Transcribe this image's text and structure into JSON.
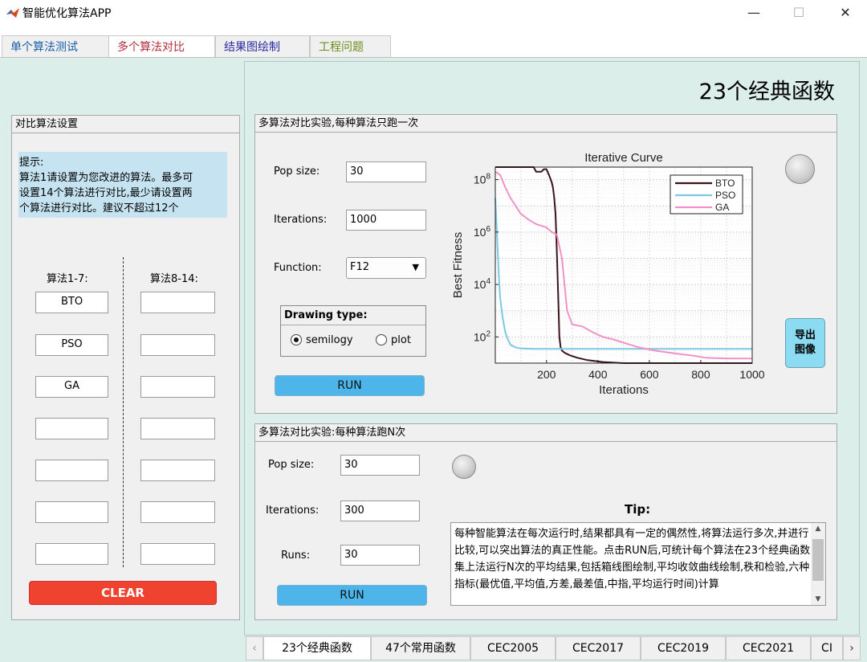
{
  "window": {
    "title": "智能优化算法APP",
    "minimize": "—",
    "maximize": "☐",
    "close": "✕"
  },
  "tabs": [
    {
      "label": "单个算法测试",
      "color": "#1a5fa8"
    },
    {
      "label": "多个算法对比",
      "color": "#b32d3a"
    },
    {
      "label": "结果图绘制",
      "color": "#2a2aa0"
    },
    {
      "label": "工程问题",
      "color": "#6c8c1c"
    }
  ],
  "heading": "23个经典函数",
  "compare_panel": {
    "title": "对比算法设置",
    "hint_lines": [
      "提示:",
      "算法1请设置为您改进的算法。最多可",
      "设置14个算法进行对比,最少请设置两",
      "个算法进行对比。建议不超过12个"
    ],
    "col1_label": "算法1-7:",
    "col2_label": "算法8-14:",
    "col1_values": [
      "BTO",
      "PSO",
      "GA",
      "",
      "",
      "",
      ""
    ],
    "col2_values": [
      "",
      "",
      "",
      "",
      "",
      "",
      ""
    ],
    "clear_label": "CLEAR"
  },
  "single_run_panel": {
    "title": "多算法对比实验,每种算法只跑一次",
    "pop_label": "Pop size:",
    "pop_value": "30",
    "iter_label": "Iterations:",
    "iter_value": "1000",
    "func_label": "Function:",
    "func_value": "F12",
    "drawing_type_label": "Drawing type:",
    "radio_semilogy": "semilogy",
    "radio_plot": "plot",
    "run_label": "RUN",
    "export_label_1": "导出",
    "export_label_2": "图像"
  },
  "multi_run_panel": {
    "title": "多算法对比实验:每种算法跑N次",
    "pop_label": "Pop size:",
    "pop_value": "30",
    "iter_label": "Iterations:",
    "iter_value": "300",
    "runs_label": "Runs:",
    "runs_value": "30",
    "run_label": "RUN",
    "tip_label": "Tip:",
    "tip_text": "每种智能算法在每次运行时,结果都具有一定的偶然性,将算法运行多次,并进行比较,可以突出算法的真正性能。点击RUN后,可统计每个算法在23个经典函数集上法运行N次的平均结果,包括箱线图绘制,平均收敛曲线绘制,秩和检验,六种指标(最优值,平均值,方差,最差值,中指,平均运行时间)计算"
  },
  "bottom_tabs": [
    "23个经典函数",
    "47个常用函数",
    "CEC2005",
    "CEC2017",
    "CEC2019",
    "CEC2021",
    "CI"
  ],
  "chart_data": {
    "type": "line",
    "title": "Iterative Curve",
    "xlabel": "Iterations",
    "ylabel": "Best Fitness",
    "xlim": [
      1,
      1000
    ],
    "ylim": [
      10,
      300000000
    ],
    "yscale": "log",
    "xticks": [
      200,
      400,
      600,
      800,
      1000
    ],
    "yticks": [
      100,
      10000,
      1000000,
      100000000
    ],
    "ytick_labels": [
      "10^2",
      "10^4",
      "10^6",
      "10^8"
    ],
    "grid": true,
    "legend_position": "top-right",
    "series": [
      {
        "name": "BTO",
        "color": "#3a1418",
        "x": [
          1,
          150,
          160,
          180,
          190,
          200,
          210,
          220,
          225,
          230,
          235,
          240,
          245,
          250,
          255,
          260,
          270,
          290,
          320,
          360,
          420,
          500,
          600,
          700,
          1000
        ],
        "y": [
          300000000,
          300000000,
          200000000,
          200000000,
          250000000,
          250000000,
          150000000,
          80000000,
          50000000,
          20000000,
          5000000,
          200000,
          5000,
          100,
          40,
          30,
          25,
          20,
          16,
          13,
          11,
          10,
          10,
          10,
          10
        ]
      },
      {
        "name": "PSO",
        "color": "#7ec8e3",
        "x": [
          1,
          5,
          10,
          15,
          20,
          30,
          40,
          50,
          60,
          80,
          100,
          150,
          200,
          400,
          600,
          800,
          1000
        ],
        "y": [
          20000000,
          3000000,
          200000,
          20000,
          3000,
          500,
          150,
          80,
          50,
          40,
          36,
          35,
          35,
          35,
          35,
          35,
          35
        ]
      },
      {
        "name": "GA",
        "color": "#f291c6",
        "x": [
          1,
          20,
          40,
          60,
          80,
          100,
          130,
          160,
          200,
          220,
          240,
          260,
          270,
          280,
          300,
          340,
          380,
          420,
          460,
          500,
          560,
          620,
          680,
          720,
          760,
          820,
          900,
          1000
        ],
        "y": [
          200000000,
          150000000,
          50000000,
          20000000,
          10000000,
          5000000,
          3000000,
          2000000,
          1500000,
          1000000,
          800000,
          100000,
          10000,
          1000,
          300,
          250,
          150,
          100,
          80,
          60,
          40,
          30,
          25,
          22,
          20,
          16,
          15,
          15
        ]
      }
    ]
  }
}
